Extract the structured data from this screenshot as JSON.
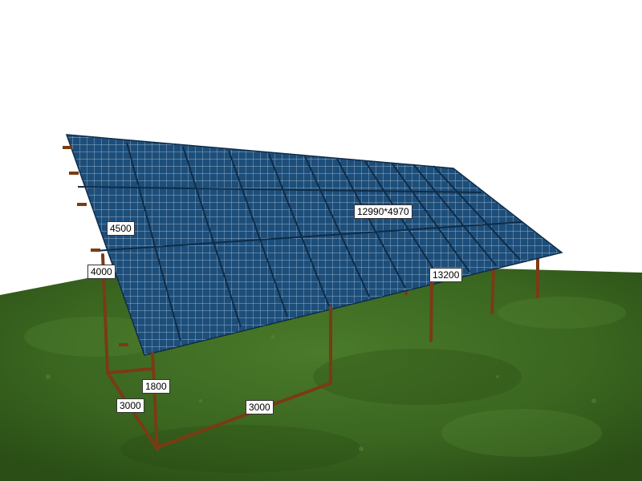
{
  "scene": {
    "subject": "ground-mounted solar panel array",
    "colors": {
      "panel": "#1d4e7a",
      "panel_dark": "#163c5e",
      "grid": "#c9d8e8",
      "frame": "#7a3b14",
      "grass": "#3d6a22",
      "sky": "#ffffff"
    }
  },
  "dimensions": {
    "array_size": "12990*4970",
    "length": "13200",
    "slope_length": "4500",
    "front_height": "4000",
    "rear_height": "1800",
    "base_depth": "3000",
    "post_spacing": "3000"
  }
}
